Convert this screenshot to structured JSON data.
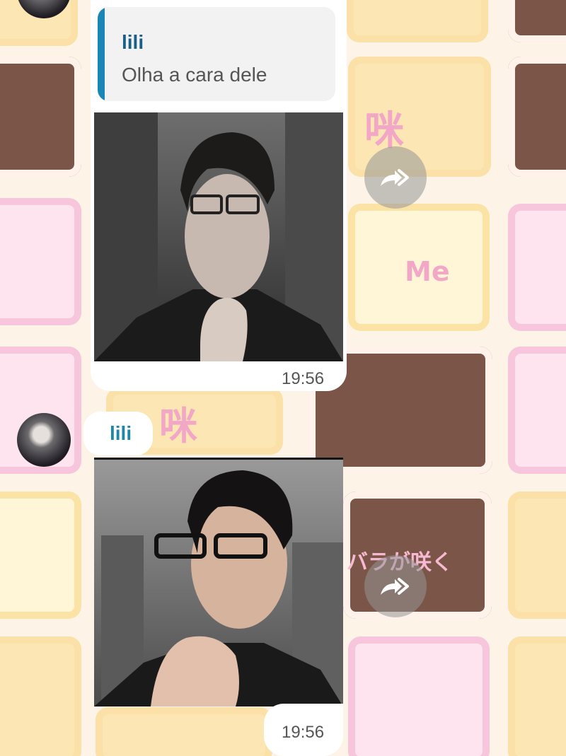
{
  "chat": {
    "messages": [
      {
        "reply_to": {
          "name": "lili",
          "text": "Olha a cara dele"
        },
        "time": "19:56"
      },
      {
        "sender": "lili",
        "time": "19:56"
      }
    ]
  },
  "wallpaper": {
    "stickers": [
      "咪",
      "Me",
      "咪",
      "バラが咲く"
    ]
  },
  "colors": {
    "reply_bar": "#1a86b8",
    "sender_name": "#1f86a8",
    "bubble": "#ffffff"
  },
  "icons": {
    "forward": "forward-double-arrow-icon"
  }
}
